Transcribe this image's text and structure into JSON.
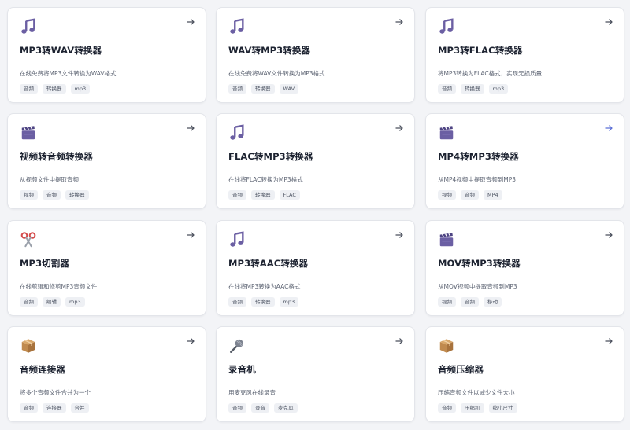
{
  "colors": {
    "icon_purple": "#6b5fa3",
    "arrow_default": "#4a4f5c",
    "arrow_active": "#5b6fd6",
    "scissors_red": "#d44a4a",
    "box_brown": "#c08a4e",
    "tag_bg": "#eef0f4"
  },
  "cards": [
    {
      "icon": "music-note-icon",
      "title": "MP3转WAV转换器",
      "desc": "在线免费将MP3文件转换为WAV格式",
      "tags": [
        "音频",
        "转换器",
        "mp3"
      ]
    },
    {
      "icon": "music-note-icon",
      "title": "WAV转MP3转换器",
      "desc": "在线免费将WAV文件转换为MP3格式",
      "tags": [
        "音频",
        "转换器",
        "WAV"
      ]
    },
    {
      "icon": "music-note-icon",
      "title": "MP3转FLAC转换器",
      "desc": "将MP3转换为FLAC格式，实现无损质量",
      "tags": [
        "音频",
        "转换器",
        "mp3"
      ]
    },
    {
      "icon": "clapperboard-icon",
      "title": "视频转音频转换器",
      "desc": "从视频文件中提取音频",
      "tags": [
        "视频",
        "音频",
        "转换器"
      ]
    },
    {
      "icon": "music-note-icon",
      "title": "FLAC转MP3转换器",
      "desc": "在线将FLAC转换为MP3格式",
      "tags": [
        "音频",
        "转换器",
        "FLAC"
      ]
    },
    {
      "icon": "clapperboard-icon",
      "title": "MP4转MP3转换器",
      "desc": "从MP4视频中提取音频到MP3",
      "tags": [
        "视频",
        "音频",
        "MP4"
      ]
    },
    {
      "icon": "scissors-icon",
      "title": "MP3切割器",
      "desc": "在线剪辑和修剪MP3音频文件",
      "tags": [
        "音频",
        "编辑",
        "mp3"
      ]
    },
    {
      "icon": "music-note-icon",
      "title": "MP3转AAC转换器",
      "desc": "在线将MP3转换为AAC格式",
      "tags": [
        "音频",
        "转换器",
        "mp3"
      ]
    },
    {
      "icon": "clapperboard-icon",
      "title": "MOV转MP3转换器",
      "desc": "从MOV视频中提取音频到MP3",
      "tags": [
        "视频",
        "音频",
        "移动"
      ]
    },
    {
      "icon": "package-icon",
      "title": "音频连接器",
      "desc": "将多个音频文件合并为一个",
      "tags": [
        "音频",
        "连接器",
        "合并"
      ]
    },
    {
      "icon": "microphone-icon",
      "title": "录音机",
      "desc": "用麦克风在线录音",
      "tags": [
        "音频",
        "录音",
        "麦克风"
      ]
    },
    {
      "icon": "package-icon",
      "title": "音频压缩器",
      "desc": "压缩音频文件以减少文件大小",
      "tags": [
        "音频",
        "压缩机",
        "缩小尺寸"
      ]
    }
  ]
}
